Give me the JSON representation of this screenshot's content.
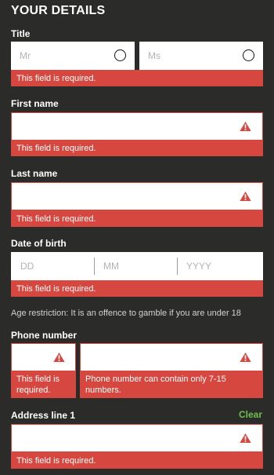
{
  "heading": "YOUR DETAILS",
  "title_field": {
    "label": "Title",
    "options": [
      "Mr",
      "Ms"
    ],
    "error": "This field is required."
  },
  "first_name": {
    "label": "First name",
    "error": "This field is required."
  },
  "last_name": {
    "label": "Last name",
    "error": "This field is required."
  },
  "dob": {
    "label": "Date of birth",
    "placeholders": [
      "DD",
      "MM",
      "YYYY"
    ],
    "error": "This field is required."
  },
  "age_note": "Age restriction: It is an offence to gamble if you are under 18",
  "phone": {
    "label": "Phone number",
    "prefix_error": "This field is required.",
    "number_error": "Phone number can contain only 7-15 numbers."
  },
  "address1": {
    "label": "Address line 1",
    "clear_label": "Clear",
    "error": "This field is required."
  },
  "colors": {
    "background": "#2b2b29",
    "error": "#d6473f",
    "clear": "#6cc24a"
  }
}
